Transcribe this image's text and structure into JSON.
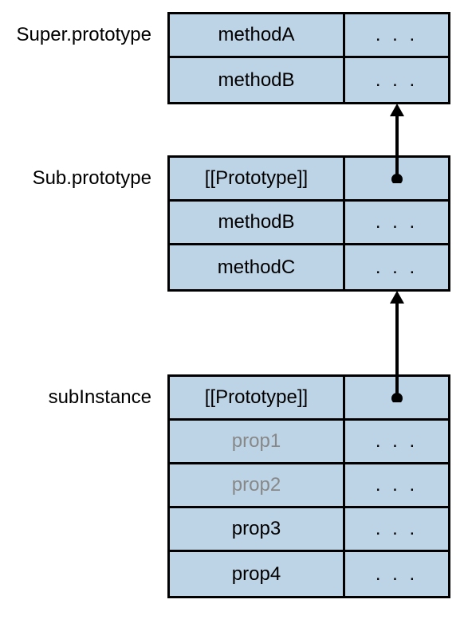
{
  "labels": {
    "super": "Super.prototype",
    "sub": "Sub.prototype",
    "instance": "subInstance"
  },
  "tables": {
    "super": {
      "rows": [
        {
          "key": "methodA",
          "val": ". . .",
          "grayed": false
        },
        {
          "key": "methodB",
          "val": ". . .",
          "grayed": false
        }
      ]
    },
    "sub": {
      "rows": [
        {
          "key": "[[Prototype]]",
          "val": "",
          "grayed": false
        },
        {
          "key": "methodB",
          "val": ". . .",
          "grayed": false
        },
        {
          "key": "methodC",
          "val": ". . .",
          "grayed": false
        }
      ]
    },
    "instance": {
      "rows": [
        {
          "key": "[[Prototype]]",
          "val": "",
          "grayed": false
        },
        {
          "key": "prop1",
          "val": ". . .",
          "grayed": true
        },
        {
          "key": "prop2",
          "val": ". . .",
          "grayed": true
        },
        {
          "key": "prop3",
          "val": ". . .",
          "grayed": false
        },
        {
          "key": "prop4",
          "val": ". . .",
          "grayed": false
        }
      ]
    }
  }
}
